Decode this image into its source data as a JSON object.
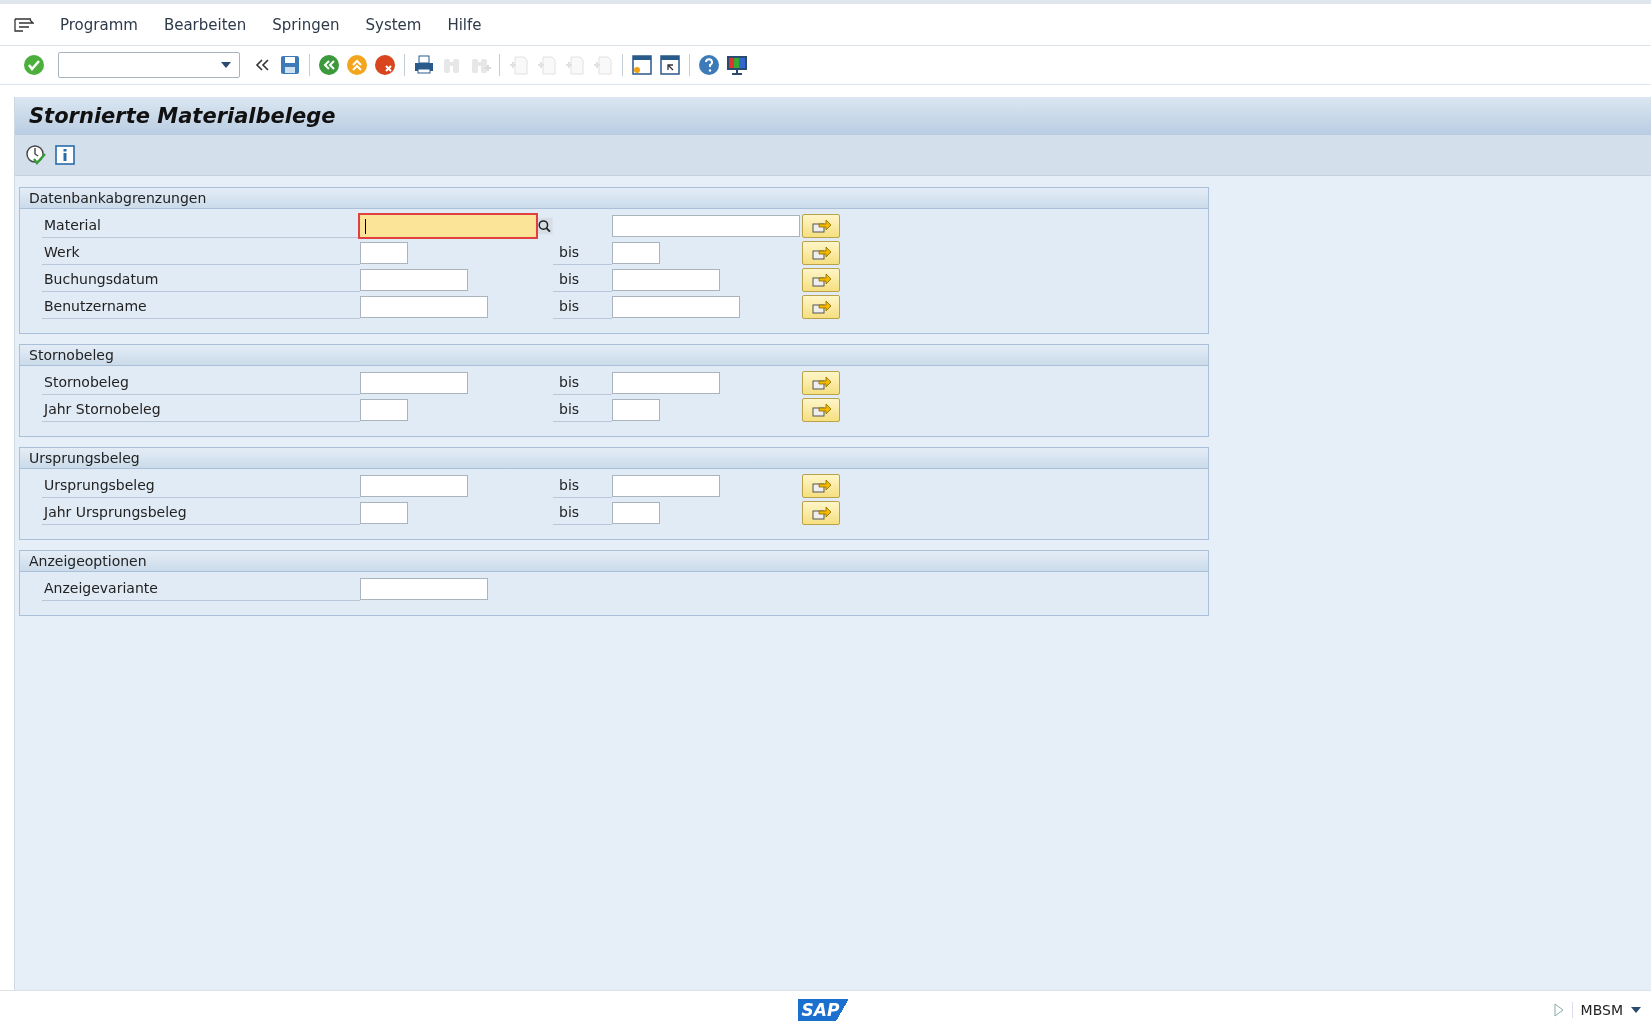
{
  "menu": [
    {
      "label": "Programm"
    },
    {
      "label": "Bearbeiten"
    },
    {
      "label": "Springen"
    },
    {
      "label": "System"
    },
    {
      "label": "Hilfe"
    }
  ],
  "toolbar": [
    {
      "kind": "enter",
      "disabled": false
    },
    {
      "kind": "command-field"
    },
    {
      "kind": "collapse",
      "disabled": false
    },
    {
      "kind": "save",
      "disabled": false
    },
    {
      "kind": "sep"
    },
    {
      "kind": "back",
      "disabled": false
    },
    {
      "kind": "exit",
      "disabled": false
    },
    {
      "kind": "cancel",
      "disabled": false
    },
    {
      "kind": "sep"
    },
    {
      "kind": "print",
      "disabled": false
    },
    {
      "kind": "find",
      "disabled": true
    },
    {
      "kind": "find-next",
      "disabled": true
    },
    {
      "kind": "sep"
    },
    {
      "kind": "first-page",
      "disabled": true
    },
    {
      "kind": "prev-page",
      "disabled": true
    },
    {
      "kind": "next-page",
      "disabled": true
    },
    {
      "kind": "last-page",
      "disabled": true
    },
    {
      "kind": "sep"
    },
    {
      "kind": "new-session",
      "disabled": false
    },
    {
      "kind": "shortcut",
      "disabled": false
    },
    {
      "kind": "sep"
    },
    {
      "kind": "help",
      "disabled": false
    },
    {
      "kind": "layout",
      "disabled": false
    }
  ],
  "title": "Stornierte Materialbelege",
  "app_toolbar": [
    {
      "kind": "execute"
    },
    {
      "kind": "info"
    }
  ],
  "groups": [
    {
      "title": "Datenbankabgrenzungen",
      "rows": [
        {
          "label": "Material",
          "kind": "xlong",
          "focused": true,
          "range": true
        },
        {
          "label": "Werk",
          "kind": "short",
          "focused": false,
          "range": true,
          "to_label": "bis"
        },
        {
          "label": "Buchungsdatum",
          "kind": "medium",
          "focused": false,
          "range": true,
          "to_label": "bis"
        },
        {
          "label": "Benutzername",
          "kind": "long",
          "focused": false,
          "range": true,
          "to_label": "bis"
        }
      ]
    },
    {
      "title": "Stornobeleg",
      "rows": [
        {
          "label": "Stornobeleg",
          "kind": "medium",
          "focused": false,
          "range": true,
          "to_label": "bis"
        },
        {
          "label": "Jahr Stornobeleg",
          "kind": "short",
          "focused": false,
          "range": true,
          "to_label": "bis"
        }
      ]
    },
    {
      "title": "Ursprungsbeleg",
      "rows": [
        {
          "label": "Ursprungsbeleg",
          "kind": "medium",
          "focused": false,
          "range": true,
          "to_label": "bis"
        },
        {
          "label": "Jahr Ursprungsbeleg",
          "kind": "short",
          "focused": false,
          "range": true,
          "to_label": "bis"
        }
      ]
    },
    {
      "title": "Anzeigeoptionen",
      "rows": [
        {
          "label": "Anzeigevariante",
          "kind": "long",
          "focused": false,
          "range": false
        }
      ]
    }
  ],
  "status_bar": {
    "logo": "SAP",
    "transaction": "MBSM"
  }
}
